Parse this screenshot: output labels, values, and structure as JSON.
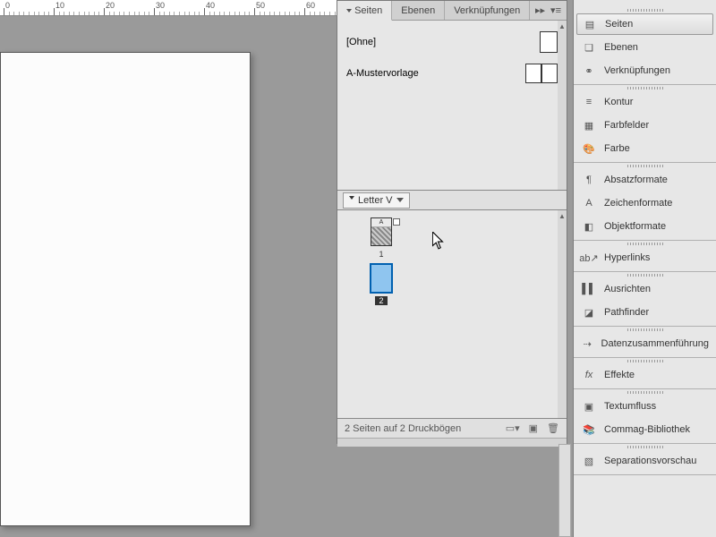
{
  "ruler": {
    "marks": [
      0,
      10,
      20,
      30,
      40,
      50,
      60
    ]
  },
  "panel": {
    "tabs": {
      "pages": "Seiten",
      "layers": "Ebenen",
      "links": "Verknüpfungen"
    },
    "masters": {
      "none": "[Ohne]",
      "a_master": "A-Mustervorlage"
    },
    "size_label": "Letter V",
    "pages": {
      "p1": "1",
      "p2": "2",
      "a_badge": "A"
    },
    "footer": "2 Seiten auf 2 Druckbögen"
  },
  "sidebar": {
    "g1": {
      "pages": "Seiten",
      "layers": "Ebenen",
      "links": "Verknüpfungen"
    },
    "g2": {
      "stroke": "Kontur",
      "swatches": "Farbfelder",
      "color": "Farbe"
    },
    "g3": {
      "para": "Absatzformate",
      "char": "Zeichenformate",
      "obj": "Objektformate"
    },
    "g4": {
      "hyper": "Hyperlinks"
    },
    "g5": {
      "align": "Ausrichten",
      "path": "Pathfinder"
    },
    "g6": {
      "datamerge": "Datenzusammenführung"
    },
    "g7": {
      "effects": "Effekte"
    },
    "g8": {
      "textwrap": "Textumfluss",
      "lib": "Commag-Bibliothek"
    },
    "g9": {
      "sep": "Separationsvorschau"
    }
  }
}
